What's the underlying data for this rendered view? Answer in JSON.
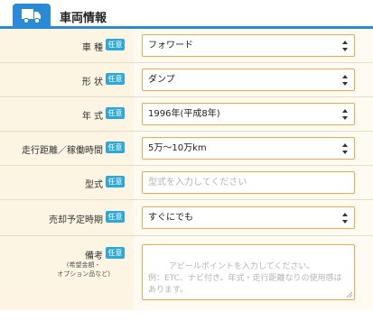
{
  "header": {
    "title": "車両情報",
    "icon": "truck-icon"
  },
  "colors": {
    "accent": "#2a8ad6",
    "badge": "#2fa8d6",
    "field_border": "#f0a848",
    "panel_bg": "#fdf5e4"
  },
  "badge_label": "任意",
  "rows": [
    {
      "label": "車 種",
      "value": "フォワード"
    },
    {
      "label": "形 状",
      "value": "ダンプ"
    },
    {
      "label": "年 式",
      "value": "1996年(平成8年)"
    },
    {
      "label": "走行距離／稼働時間",
      "value": "5万〜10万km"
    },
    {
      "label": "型式",
      "placeholder": "型式を入力してください"
    },
    {
      "label": "売却予定時期",
      "value": "すぐにでも"
    },
    {
      "label": "備考",
      "sublabel": "(希望金額・\nオプション品など)",
      "placeholder": "アピールポイントを入力してください。\n例：ETC、ナビ付き。年式・走行距離なりの使用感はあります。"
    }
  ]
}
